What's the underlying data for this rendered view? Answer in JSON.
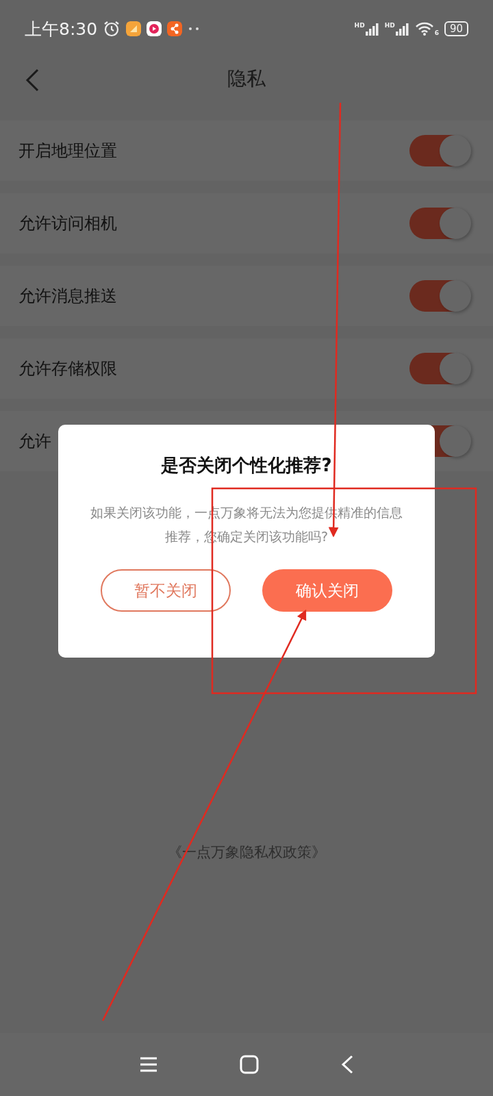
{
  "status_bar": {
    "time": "上午8:30",
    "signals": [
      {
        "label": "HD"
      },
      {
        "label": "HD"
      }
    ],
    "wifi_label": "6",
    "battery": "90"
  },
  "header": {
    "title": "隐私"
  },
  "settings": [
    {
      "label": "开启地理位置",
      "on": true
    },
    {
      "label": "允许访问相机",
      "on": true
    },
    {
      "label": "允许消息推送",
      "on": true
    },
    {
      "label": "允许存储权限",
      "on": true
    },
    {
      "label": "允许",
      "on": true
    }
  ],
  "policy_link": "《一点万象隐私权政策》",
  "dialog": {
    "title": "是否关闭个性化推荐?",
    "message": "如果关闭该功能，一点万象将无法为您提供精准的信息推荐，您确定关闭该功能吗?",
    "buttons": [
      {
        "label": "暂不关闭",
        "kind": "outline"
      },
      {
        "label": "确认关闭",
        "kind": "primary"
      }
    ]
  }
}
